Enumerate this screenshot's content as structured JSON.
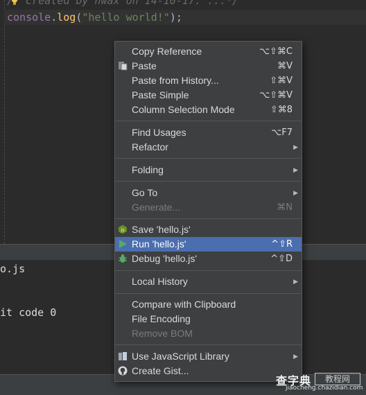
{
  "editor": {
    "comment": "/* Created by nwax on 14-10-17. ...*/",
    "code": {
      "obj": "console",
      "dot": ".",
      "fn": "log",
      "open": "(",
      "str": "\"hello world!\"",
      "close": ");"
    }
  },
  "console": {
    "line1": "o.js",
    "line2": "it code 0"
  },
  "menu": {
    "items": [
      {
        "label": "Copy Reference",
        "shortcut": "⌥⇧⌘C"
      },
      {
        "label": "Paste",
        "shortcut": "⌘V",
        "icon": "paste-icon"
      },
      {
        "label": "Paste from History...",
        "shortcut": "⇧⌘V"
      },
      {
        "label": "Paste Simple",
        "shortcut": "⌥⇧⌘V"
      },
      {
        "label": "Column Selection Mode",
        "shortcut": "⇧⌘8"
      },
      {
        "label": "Find Usages",
        "shortcut": "⌥F7"
      },
      {
        "label": "Refactor",
        "submenu": "▶"
      },
      {
        "label": "Folding",
        "submenu": "▶"
      },
      {
        "label": "Go To",
        "submenu": "▶"
      },
      {
        "label": "Generate...",
        "shortcut": "⌘N",
        "disabled": true
      },
      {
        "label": "Save 'hello.js'",
        "icon": "nodejs-icon"
      },
      {
        "label": "Run 'hello.js'",
        "shortcut": "^⇧R",
        "icon": "run-icon",
        "selected": true
      },
      {
        "label": "Debug 'hello.js'",
        "shortcut": "^⇧D",
        "icon": "debug-icon"
      },
      {
        "label": "Local History",
        "submenu": "▶"
      },
      {
        "label": "Compare with Clipboard"
      },
      {
        "label": "File Encoding"
      },
      {
        "label": "Remove BOM",
        "disabled": true
      },
      {
        "label": "Use JavaScript Library",
        "submenu": "▶",
        "icon": "library-icon"
      },
      {
        "label": "Create Gist...",
        "icon": "github-icon"
      }
    ]
  },
  "watermark": {
    "brand": "查字典",
    "tag": "教程网",
    "url": "jiaocheng.chazidian.com"
  },
  "colors": {
    "menu_bg": "#3d3f41",
    "selected": "#4b6eaf",
    "run_green": "#59a869"
  }
}
